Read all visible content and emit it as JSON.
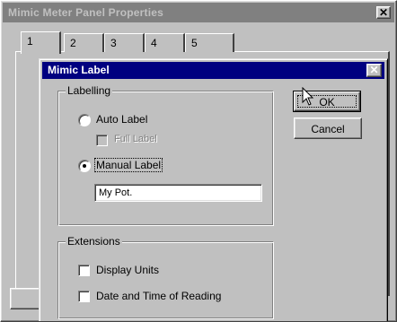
{
  "outer_window": {
    "title": "Mimic Meter Panel Properties",
    "close_glyph": "✕",
    "tabs": [
      {
        "label": "1"
      },
      {
        "label": "2"
      },
      {
        "label": "3"
      },
      {
        "label": "4"
      },
      {
        "label": "5"
      }
    ]
  },
  "dialog": {
    "title": "Mimic Label",
    "close_glyph": "✕",
    "labelling": {
      "group_label": "Labelling",
      "auto_label": "Auto Label",
      "full_label": "Full Label",
      "manual_label": "Manual Label",
      "manual_value": "My Pot.",
      "selected": "manual",
      "full_label_enabled": false
    },
    "extensions": {
      "group_label": "Extensions",
      "display_units": "Display Units",
      "date_time": "Date and Time of Reading",
      "display_units_checked": false,
      "date_time_checked": false
    },
    "ok_label": "OK",
    "cancel_label": "Cancel"
  },
  "cursor_icon": "arrow-pointer-icon",
  "colors": {
    "active_title": "#000080",
    "inactive_title": "#808080",
    "face": "#c0c0c0"
  }
}
